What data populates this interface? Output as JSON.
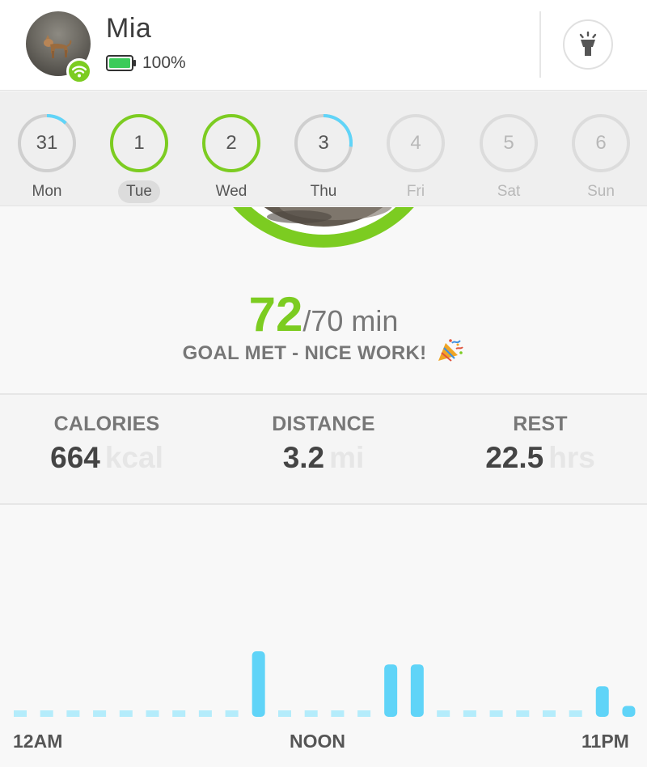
{
  "profile": {
    "name": "Mia",
    "battery_text": "100%",
    "battery_level": 1.0,
    "icons": {
      "avatar": "dog-photo",
      "wifi": "wifi-icon",
      "battery": "battery-full-icon",
      "light": "flashlight-icon"
    }
  },
  "colors": {
    "accent_green": "#7ccc21",
    "activity_blue": "#60d4f8",
    "ring_gray": "#cfcfcf"
  },
  "week": {
    "days": [
      {
        "num": "31",
        "label": "Mon",
        "progress": 0.12,
        "state": "past"
      },
      {
        "num": "1",
        "label": "Tue",
        "progress": 1.0,
        "state": "selected"
      },
      {
        "num": "2",
        "label": "Wed",
        "progress": 1.0,
        "state": "past"
      },
      {
        "num": "3",
        "label": "Thu",
        "progress": 0.27,
        "state": "past"
      },
      {
        "num": "4",
        "label": "Fri",
        "progress": 0,
        "state": "future"
      },
      {
        "num": "5",
        "label": "Sat",
        "progress": 0,
        "state": "future"
      },
      {
        "num": "6",
        "label": "Sun",
        "progress": 0,
        "state": "future"
      }
    ]
  },
  "goal": {
    "value": "72",
    "rest": "/70 min",
    "status": "GOAL MET - NICE WORK!",
    "status_icon": "party-popper-icon",
    "progress": 1.0
  },
  "stats": [
    {
      "label": "CALORIES",
      "value": "664",
      "unit": "kcal"
    },
    {
      "label": "DISTANCE",
      "value": "3.2",
      "unit": "mi"
    },
    {
      "label": "REST",
      "value": "22.5",
      "unit": "hrs"
    }
  ],
  "chart_data": {
    "type": "bar",
    "title": "",
    "x_labels": [
      "12AM",
      "NOON",
      "11PM"
    ],
    "hours": [
      0,
      1,
      2,
      3,
      4,
      5,
      6,
      7,
      8,
      9,
      10,
      11,
      12,
      13,
      14,
      15,
      16,
      17,
      18,
      19,
      20,
      21,
      22,
      23
    ],
    "values": [
      0,
      0,
      0,
      0,
      0,
      0,
      0,
      0,
      0,
      0.9,
      0,
      0,
      0,
      0,
      0.72,
      0.72,
      0,
      0,
      0,
      0,
      0,
      0,
      0.42,
      0.15
    ],
    "ylim": [
      0,
      1
    ],
    "grid": false
  }
}
